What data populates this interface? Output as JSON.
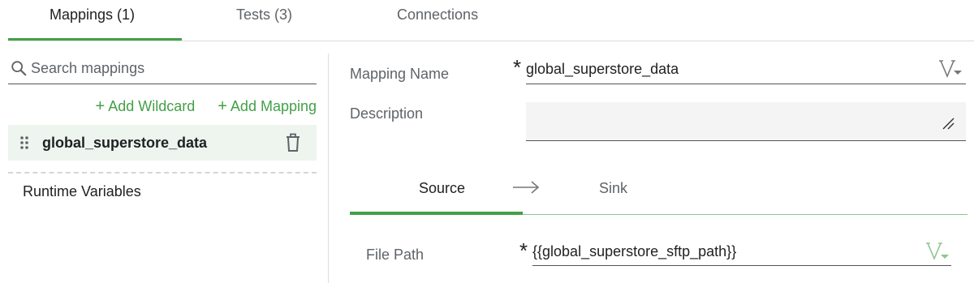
{
  "tabs": [
    {
      "label": "Mappings (1)",
      "active": true
    },
    {
      "label": "Tests (3)",
      "active": false
    },
    {
      "label": "Connections",
      "active": false
    }
  ],
  "sidebar": {
    "search_placeholder": "Search mappings",
    "add_wildcard": "Add Wildcard",
    "add_mapping": "Add Mapping",
    "plus": "+",
    "mappings": [
      {
        "label": "global_superstore_data",
        "selected": true
      }
    ],
    "runtime_variables": "Runtime Variables"
  },
  "form": {
    "required_mark": "*",
    "mapping_name_label": "Mapping Name",
    "mapping_name_value": "global_superstore_data",
    "description_label": "Description",
    "description_value": "",
    "file_path_label": "File Path",
    "file_path_value": "{{global_superstore_sftp_path}}"
  },
  "subtabs": [
    {
      "label": "Source",
      "active": true
    },
    {
      "label": "Sink",
      "active": false
    }
  ],
  "icons": {
    "search": "search-icon",
    "drag": "drag-handle-icon",
    "trash": "trash-icon",
    "variable": "variable-picker-icon",
    "resize": "resize-handle-icon",
    "arrow": "arrow-right-icon"
  },
  "colors": {
    "accent": "#43a047",
    "selected_bg": "#edf5ee",
    "text": "#202124",
    "muted": "#5f6368"
  }
}
